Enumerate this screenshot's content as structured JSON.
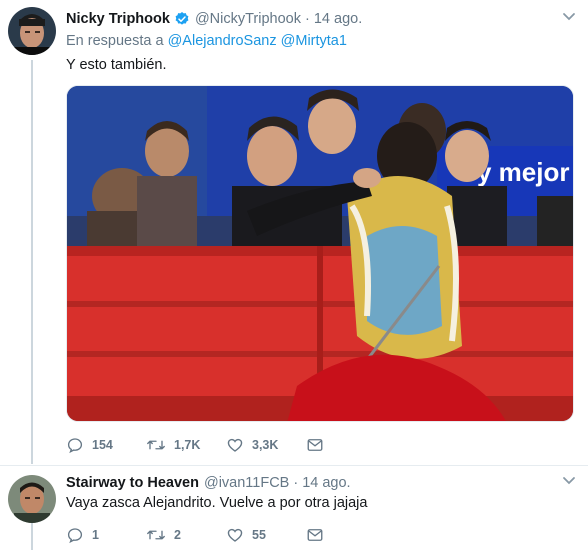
{
  "tweet1": {
    "name": "Nicky Triphook",
    "handle": "@NickyTriphook",
    "separator": "·",
    "time": "14 ago.",
    "reply_prefix": "En respuesta a",
    "mention1": "@AlejandroSanz",
    "mention2": "@Mirtyta1",
    "text": "Y esto también.",
    "media_banner_text": "y mejor",
    "actions": {
      "replies": "154",
      "retweets": "1,7K",
      "likes": "3,3K"
    }
  },
  "tweet2": {
    "name": "Stairway to Heaven",
    "handle": "@ivan11FCB",
    "separator": "·",
    "time": "14 ago.",
    "text": "Vaya zasca Alejandrito. Vuelve a por otra jajaja",
    "actions": {
      "replies": "1",
      "retweets": "2",
      "likes": "55"
    }
  },
  "colors": {
    "link": "#1b95e0",
    "muted": "#657786",
    "line": "#ccd6dd",
    "verified": "#1da1f2"
  }
}
